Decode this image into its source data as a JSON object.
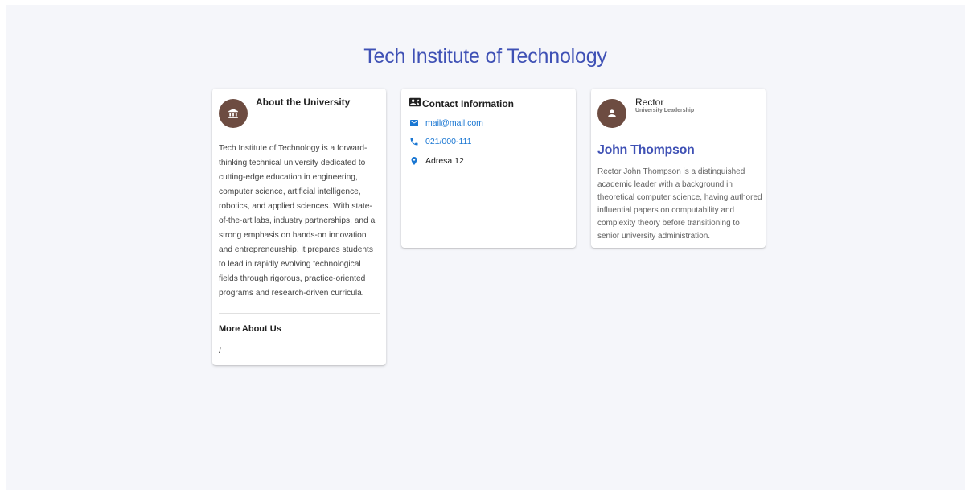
{
  "page": {
    "title": "Tech Institute of Technology"
  },
  "about": {
    "icon": "university-icon",
    "title": "About the University",
    "description": "Tech Institute of Technology is a forward-thinking technical university dedicated to cutting-edge education in engineering, computer science, artificial intelligence, robotics, and applied sciences. With state-of-the-art labs, industry partnerships, and a strong emphasis on hands-on innovation and entrepreneurship, it prepares students to lead in rapidly evolving technological fields through rigorous, practice-oriented programs and research-driven curricula.",
    "more_title": "More About Us",
    "more_value": "/"
  },
  "contact": {
    "icon": "contact-card-icon",
    "title": "Contact Information",
    "email": "mail@mail.com",
    "phone": "021/000-111",
    "address": "Adresa 12"
  },
  "rector": {
    "icon": "person-icon",
    "title": "Rector",
    "subtitle": "University Leadership",
    "name": "John Thompson",
    "bio": "Rector John Thompson is a distinguished academic leader with a background in theoretical computer science, having authored influential papers on computability and complexity theory before transitioning to senior university administration."
  },
  "colors": {
    "accent": "#3f51b5",
    "link": "#1976d2",
    "avatar": "#6d4c41",
    "background": "#f5f6fa"
  }
}
